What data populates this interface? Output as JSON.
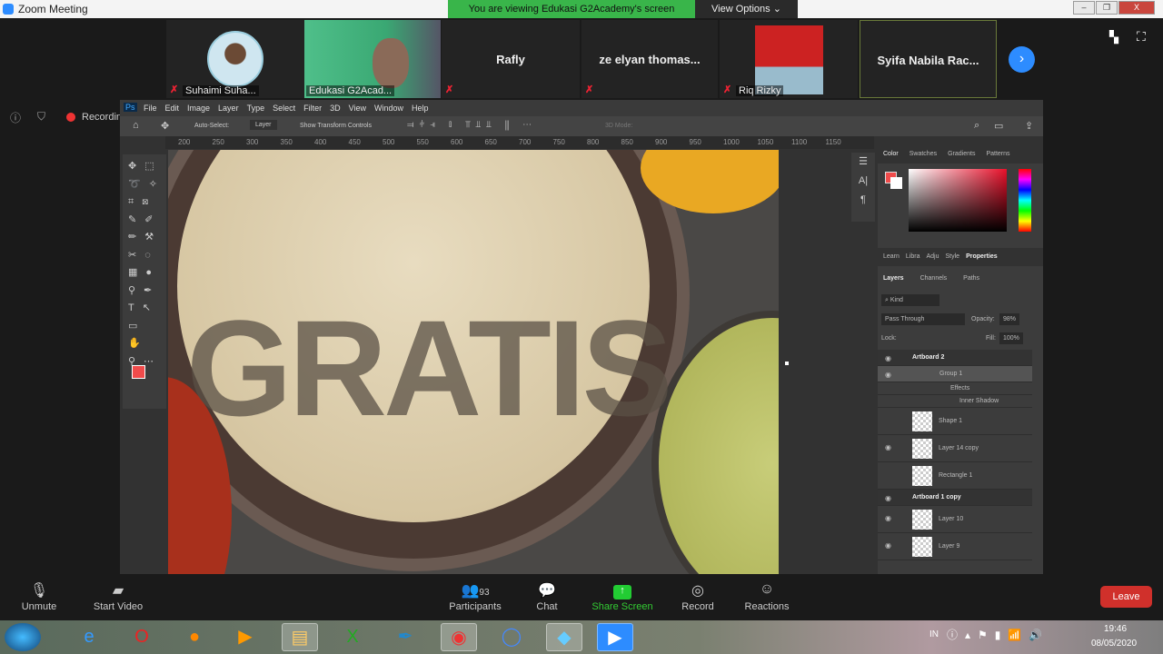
{
  "window": {
    "title": "Zoom Meeting",
    "banner": "You are viewing Edukasi G2Academy's screen",
    "view_options": "View Options ⌄"
  },
  "participants": [
    {
      "name": "Suhaimi Suha..."
    },
    {
      "name": "Edukasi G2Acad..."
    },
    {
      "name": "Rafly"
    },
    {
      "name": "ze elyan thomas..."
    },
    {
      "name": "Riq Rizky"
    },
    {
      "name": "Syifa Nabila Rac..."
    }
  ],
  "status": {
    "recording": "Recording"
  },
  "photoshop": {
    "menu": [
      "File",
      "Edit",
      "Image",
      "Layer",
      "Type",
      "Select",
      "Filter",
      "3D",
      "View",
      "Window",
      "Help"
    ],
    "options": {
      "auto_select": "Auto-Select:",
      "layer_select": "Layer",
      "show_transform": "Show Transform Controls",
      "mode_3d": "3D Mode:"
    },
    "ruler": [
      "200",
      "250",
      "300",
      "350",
      "400",
      "450",
      "500",
      "550",
      "600",
      "650",
      "700",
      "750",
      "800",
      "850",
      "900",
      "950",
      "1000",
      "1050",
      "1100",
      "1150"
    ],
    "canvas_text": "GRATIS",
    "color_tabs": [
      "Color",
      "Swatches",
      "Gradients",
      "Patterns"
    ],
    "mid_tabs": [
      "Learn",
      "Libra",
      "Adju",
      "Style",
      "Properties"
    ],
    "layer_tabs": [
      "Layers",
      "Channels",
      "Paths"
    ],
    "filter_kind": "Kind",
    "blend_mode": "Pass Through",
    "opacity_label": "Opacity:",
    "opacity": "98%",
    "lock_label": "Lock:",
    "fill_label": "Fill:",
    "fill": "100%",
    "layers": [
      {
        "name": "Artboard 2",
        "type": "artboard"
      },
      {
        "name": "Group 1",
        "type": "group"
      },
      {
        "name": "Effects",
        "type": "effect"
      },
      {
        "name": "Inner Shadow",
        "type": "effect2"
      },
      {
        "name": "Shape 1"
      },
      {
        "name": "Layer 14 copy"
      },
      {
        "name": "Rectangle 1"
      },
      {
        "name": "Artboard 1 copy",
        "type": "artboard"
      },
      {
        "name": "Layer 10"
      },
      {
        "name": "Layer 9"
      }
    ],
    "foreground_color": "#f04b4b"
  },
  "toolbar": {
    "unmute": "Unmute",
    "start_video": "Start Video",
    "participants": "Participants",
    "participants_count": "93",
    "chat": "Chat",
    "share_screen": "Share Screen",
    "record": "Record",
    "reactions": "Reactions",
    "leave": "Leave"
  },
  "taskbar": {
    "lang": "IN",
    "time": "19:46",
    "date": "08/05/2020"
  }
}
